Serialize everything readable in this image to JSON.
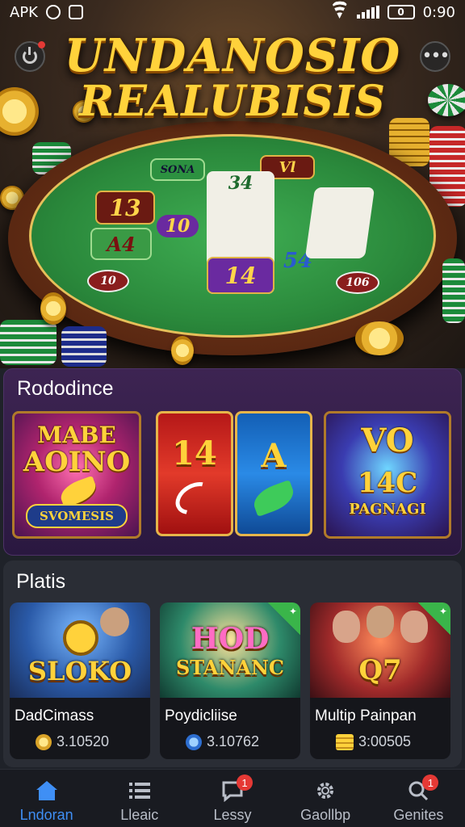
{
  "status_bar": {
    "carrier": "APK",
    "battery": "0",
    "time": "0:90"
  },
  "hero": {
    "title_line1": "UNDANOSIO",
    "title_line2": "REALUBISIS",
    "table": {
      "tile_13": "13",
      "tile_a4": "A4",
      "tile_34": "34",
      "tile_10": "10",
      "tile_14": "14",
      "tile_54": "54",
      "tile_vl": "Vl",
      "tile_sona": "SONA",
      "chip_left": "10",
      "chip_right": "106"
    }
  },
  "section_featured": {
    "title": "Rododince",
    "card1": {
      "line1": "MABE",
      "line2": "AOINO",
      "label": "SVOMESIS"
    },
    "card2": {
      "value": "14"
    },
    "card3": {
      "value": "A"
    },
    "card4": {
      "line1": "VO",
      "line2": "14C",
      "line3": "PAGNAGI"
    }
  },
  "section_platis": {
    "title": "Platis",
    "games": [
      {
        "art_text": "SLOKO",
        "name": "DadCimass",
        "count": "3.10520",
        "coin": "gold-coin-icon"
      },
      {
        "art_text_1": "HOD",
        "art_text_2": "STANANC",
        "name": "Poydicliise",
        "count": "3.10762",
        "coin": "euro-coin-icon"
      },
      {
        "art_text": "Q7",
        "name": "Multip Painpan",
        "count": "3:00505",
        "coin": "coin-stack-icon"
      }
    ]
  },
  "bottom_nav": {
    "items": [
      {
        "label": "Lndoran",
        "icon": "home-icon",
        "active": true
      },
      {
        "label": "Lleaic",
        "icon": "list-icon",
        "active": false
      },
      {
        "label": "Lessy",
        "icon": "chat-icon",
        "active": false,
        "badge": "1"
      },
      {
        "label": "Gaollbp",
        "icon": "gear-icon",
        "active": false
      },
      {
        "label": "Genites",
        "icon": "search-icon",
        "active": false,
        "badge": "1"
      }
    ]
  },
  "colors": {
    "accent": "#3f8ff5",
    "gold": "#ffd23b",
    "badge": "#e53935",
    "felt": "#2b8a3c"
  }
}
